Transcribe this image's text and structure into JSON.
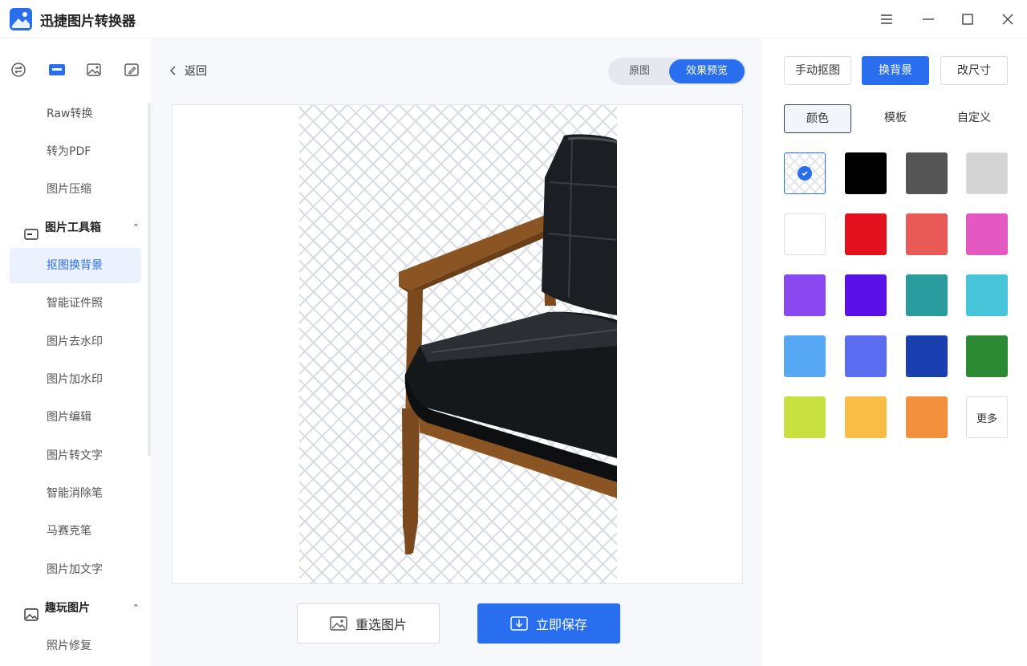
{
  "app": {
    "title": "迅捷图片转换器"
  },
  "window_controls": {
    "menu_icon": "menu-icon",
    "minimize_icon": "minimize-icon",
    "maximize_icon": "maximize-icon",
    "close_icon": "close-icon"
  },
  "sidebar": {
    "top_icons": [
      "convert-icon",
      "toolbox-icon",
      "image-icon",
      "edit-icon"
    ],
    "items_before": [
      {
        "label": "Raw转换"
      },
      {
        "label": "转为PDF"
      },
      {
        "label": "图片压缩"
      }
    ],
    "group_toolbox": {
      "label": "图片工具箱",
      "caret": "⌃"
    },
    "toolbox_items": [
      {
        "label": "抠图换背景",
        "active": true
      },
      {
        "label": "智能证件照"
      },
      {
        "label": "图片去水印"
      },
      {
        "label": "图片加水印"
      },
      {
        "label": "图片编辑"
      },
      {
        "label": "图片转文字"
      },
      {
        "label": "智能消除笔"
      },
      {
        "label": "马赛克笔"
      },
      {
        "label": "图片加文字"
      }
    ],
    "group_fun": {
      "label": "趣玩图片",
      "caret": "⌃"
    },
    "fun_items": [
      {
        "label": "照片修复"
      }
    ]
  },
  "main": {
    "back_label": "返回",
    "toggle": {
      "original": "原图",
      "preview": "效果预览"
    },
    "reselect_label": "重选图片",
    "save_label": "立即保存"
  },
  "panel": {
    "modes": [
      {
        "label": "手动抠图",
        "active": false
      },
      {
        "label": "换背景",
        "active": true
      },
      {
        "label": "改尺寸",
        "active": false
      }
    ],
    "sub_tabs": [
      {
        "label": "颜色",
        "active": true
      },
      {
        "label": "模板",
        "active": false
      },
      {
        "label": "自定义",
        "active": false
      }
    ],
    "more_label": "更多",
    "selected_swatch": "transparent",
    "swatch_colors": [
      "transparent",
      "#000000",
      "#555555",
      "#d4d4d4",
      "#ffffff",
      "#e3101e",
      "#e85a55",
      "#e458c2",
      "#8b48f0",
      "#5a10e8",
      "#2a9ca0",
      "#48c4d8",
      "#56a8f5",
      "#5a6cf0",
      "#1a3fb0",
      "#2d8a34",
      "#c8e040",
      "#f7bd45",
      "#f2903e"
    ]
  }
}
